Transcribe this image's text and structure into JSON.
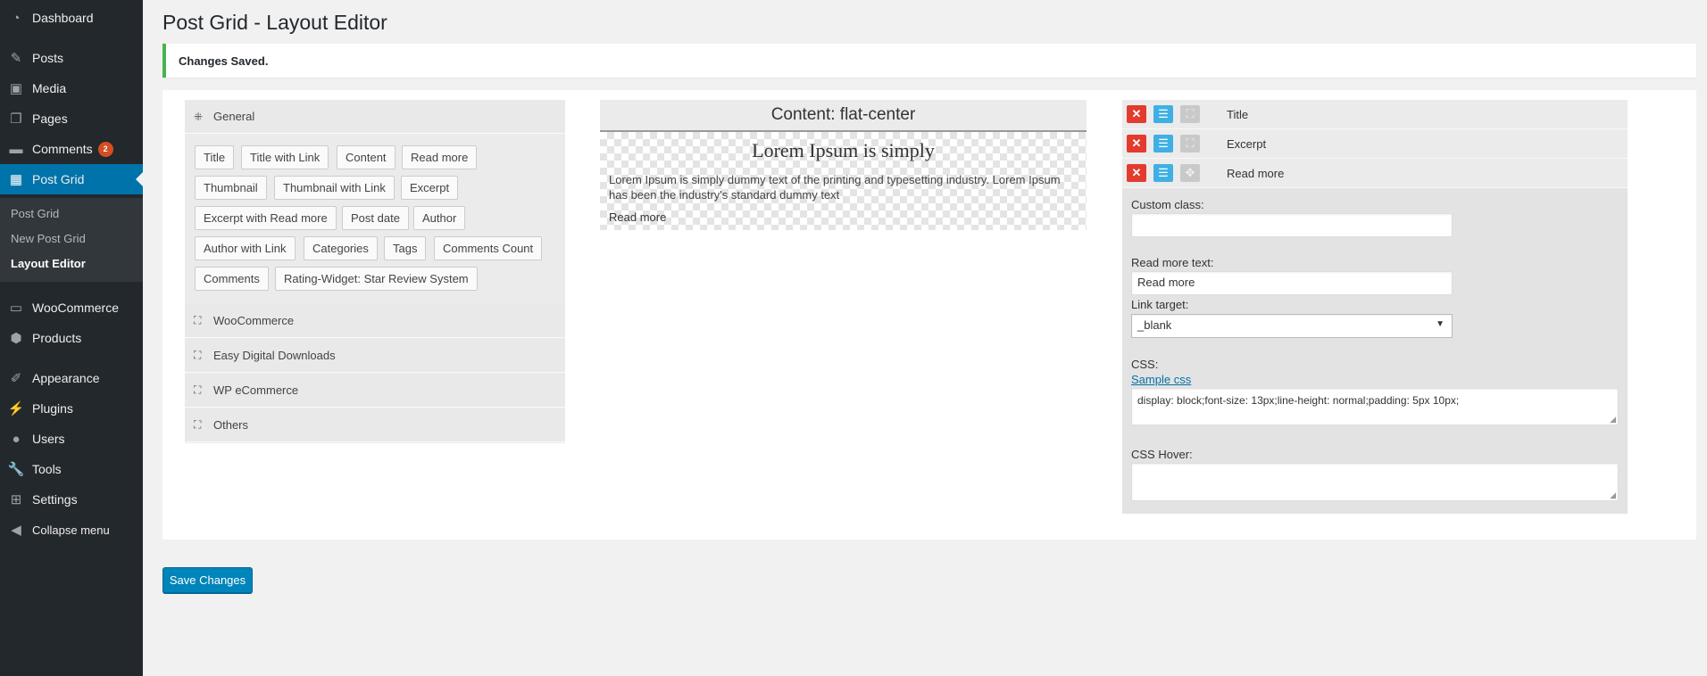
{
  "sidebar": {
    "items": [
      {
        "label": "Dashboard",
        "icon": "dashboard-icon"
      },
      {
        "label": "Posts",
        "icon": "pin-icon"
      },
      {
        "label": "Media",
        "icon": "media-icon"
      },
      {
        "label": "Pages",
        "icon": "pages-icon"
      },
      {
        "label": "Comments",
        "icon": "comments-icon",
        "badge": "2"
      },
      {
        "label": "Post Grid",
        "icon": "grid-icon"
      },
      {
        "label": "WooCommerce",
        "icon": "woo-icon"
      },
      {
        "label": "Products",
        "icon": "box-icon"
      },
      {
        "label": "Appearance",
        "icon": "brush-icon"
      },
      {
        "label": "Plugins",
        "icon": "plug-icon"
      },
      {
        "label": "Users",
        "icon": "user-icon"
      },
      {
        "label": "Tools",
        "icon": "wrench-icon"
      },
      {
        "label": "Settings",
        "icon": "settings-icon"
      },
      {
        "label": "Collapse menu",
        "icon": "collapse-icon"
      }
    ],
    "submenu": [
      "Post Grid",
      "New Post Grid",
      "Layout Editor"
    ]
  },
  "page": {
    "title": "Post Grid - Layout Editor",
    "notice": "Changes Saved.",
    "save_label": "Save Changes"
  },
  "elements": {
    "general_label": "General",
    "buttons": [
      "Title",
      "Title with Link",
      "Content",
      "Read more",
      "Thumbnail",
      "Thumbnail with Link",
      "Excerpt",
      "Excerpt with Read more",
      "Post date",
      "Author",
      "Author with Link",
      "Categories",
      "Tags",
      "Comments Count",
      "Comments",
      "Rating-Widget: Star Review System"
    ],
    "sections": [
      "WooCommerce",
      "Easy Digital Downloads",
      "WP eCommerce",
      "Others"
    ]
  },
  "preview": {
    "header": "Content: flat-center",
    "title": "Lorem Ipsum is simply",
    "excerpt": "Lorem Ipsum is simply dummy text of the printing and typesetting industry. Lorem Ipsum has been the industry's standard dummy text",
    "read_more": "Read more"
  },
  "layout": {
    "rows": [
      "Title",
      "Excerpt",
      "Read more"
    ],
    "custom_class_label": "Custom class:",
    "custom_class_value": "",
    "read_more_text_label": "Read more text:",
    "read_more_text_value": "Read more",
    "link_target_label": "Link target:",
    "link_target_value": "_blank",
    "css_label": "CSS:",
    "sample_css_link": "Sample css",
    "css_value": "display: block;font-size: 13px;line-height: normal;padding: 5px 10px;",
    "css_hover_label": "CSS Hover:",
    "css_hover_value": ""
  },
  "colors": {
    "accent": "#0073aa",
    "notice_border": "#46b450",
    "badge": "#d54e21",
    "remove_icon": "#e33b2e",
    "edit_icon": "#3fb0e4"
  }
}
